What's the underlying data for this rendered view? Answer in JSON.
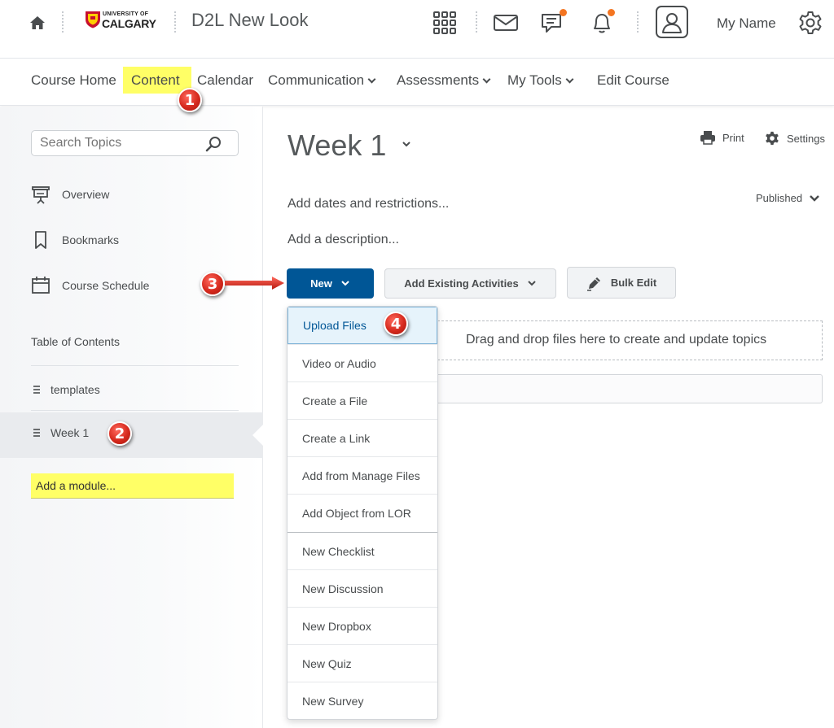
{
  "header": {
    "home_icon": "home-icon",
    "logo_line1": "UNIVERSITY OF",
    "logo_line2": "CALGARY",
    "course_title": "D2L New Look",
    "user_name": "My Name",
    "notification_color": "#f47521"
  },
  "nav": {
    "items": [
      {
        "label": "Course Home",
        "has_menu": false
      },
      {
        "label": "Content",
        "has_menu": false,
        "highlighted": true
      },
      {
        "label": "Calendar",
        "has_menu": false
      },
      {
        "label": "Communication",
        "has_menu": true
      },
      {
        "label": "Assessments",
        "has_menu": true
      },
      {
        "label": "My Tools",
        "has_menu": true
      },
      {
        "label": "Edit Course",
        "has_menu": false
      }
    ],
    "highlight_color": "#ffff66"
  },
  "sidebar": {
    "search_placeholder": "Search Topics",
    "items": [
      {
        "label": "Overview",
        "icon": "presentation-icon"
      },
      {
        "label": "Bookmarks",
        "icon": "bookmark-icon"
      },
      {
        "label": "Course Schedule",
        "icon": "calendar-icon"
      }
    ],
    "toc_heading": "Table of Contents",
    "modules": [
      {
        "label": "templates",
        "selected": false
      },
      {
        "label": "Week 1",
        "selected": true
      }
    ],
    "add_module_placeholder": "Add a module..."
  },
  "main": {
    "title": "Week 1",
    "print_label": "Print",
    "settings_label": "Settings",
    "add_dates_label": "Add dates and restrictions...",
    "published_label": "Published",
    "add_description_label": "Add a description...",
    "new_button_label": "New",
    "add_existing_label": "Add Existing Activities",
    "bulk_edit_label": "Bulk Edit",
    "dropzone_text": "Drag and drop files here to create and update topics",
    "primary_color": "#005696"
  },
  "new_menu": {
    "items": [
      "Upload Files",
      "Video or Audio",
      "Create a File",
      "Create a Link",
      "Add from Manage Files",
      "Add Object from LOR",
      "New Checklist",
      "New Discussion",
      "New Dropbox",
      "New Quiz",
      "New Survey"
    ],
    "active_index": 0
  },
  "annotations": {
    "badges": [
      "1",
      "2",
      "3",
      "4"
    ],
    "badge_color": "#d62a1e"
  }
}
